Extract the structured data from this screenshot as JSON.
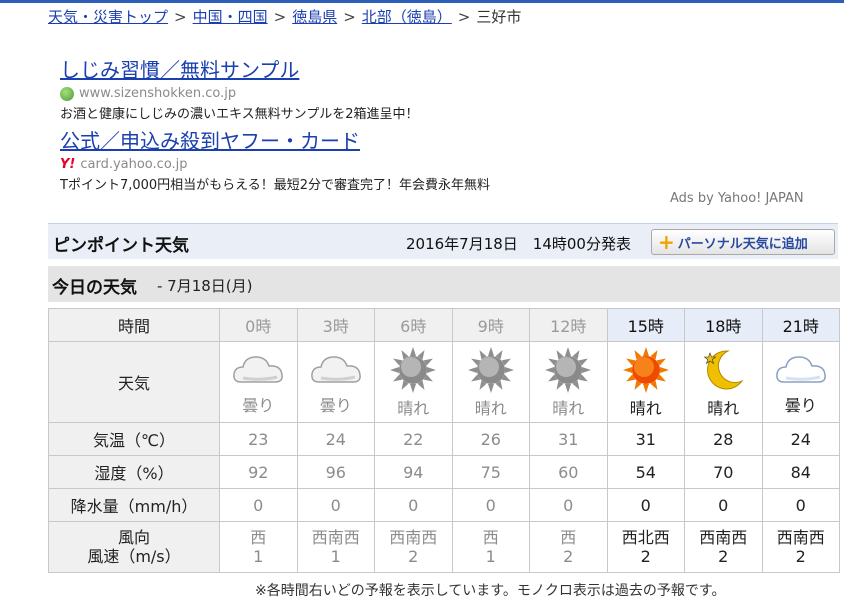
{
  "breadcrumb": {
    "items": [
      "天気・災害トップ",
      "中国・四国",
      "徳島県",
      "北部（徳島）"
    ],
    "current": "三好市",
    "separator": ">"
  },
  "ads": [
    {
      "title": "しじみ習慣／無料サンプル",
      "url": "www.sizenshokken.co.jp",
      "desc": "お酒と健康にしじみの濃いエキス無料サンプルを2箱進呈中！",
      "icon": "globe-icon"
    },
    {
      "title": "公式／申込み殺到ヤフー・カード",
      "url": "card.yahoo.co.jp",
      "desc": "Tポイント7,000円相当がもらえる！最短2分で審査完了！年会費永年無料",
      "icon": "yahoo-y-icon",
      "logo_text": "Y!"
    }
  ],
  "ads_by": "Ads by Yahoo! JAPAN",
  "pinpoint": {
    "title": "ピンポイント天気",
    "date": "2016年7月18日　14時00分発表",
    "add_button": "パーソナル天気に追加",
    "add_icon": "+"
  },
  "today": {
    "title": "今日の天気",
    "date": " - 7月18日(月)"
  },
  "table": {
    "row_labels": {
      "time": "時間",
      "weather": "天気",
      "temp": "気温（℃）",
      "humidity": "湿度（%）",
      "precip": "降水量（mm/h）",
      "wind_dir": "風向",
      "wind_speed": "風速（m/s）"
    },
    "columns": [
      {
        "hour": "0時",
        "weather": "曇り",
        "icon": "cloud-icon",
        "temp": "23",
        "humidity": "92",
        "precip": "0",
        "wind_dir": "西",
        "wind_speed": "1",
        "past": true
      },
      {
        "hour": "3時",
        "weather": "曇り",
        "icon": "cloud-icon",
        "temp": "24",
        "humidity": "96",
        "precip": "0",
        "wind_dir": "西南西",
        "wind_speed": "1",
        "past": true
      },
      {
        "hour": "6時",
        "weather": "晴れ",
        "icon": "sun-icon",
        "temp": "22",
        "humidity": "94",
        "precip": "0",
        "wind_dir": "西南西",
        "wind_speed": "2",
        "past": true
      },
      {
        "hour": "9時",
        "weather": "晴れ",
        "icon": "sun-icon",
        "temp": "26",
        "humidity": "75",
        "precip": "0",
        "wind_dir": "西",
        "wind_speed": "1",
        "past": true
      },
      {
        "hour": "12時",
        "weather": "晴れ",
        "icon": "sun-icon",
        "temp": "31",
        "humidity": "60",
        "precip": "0",
        "wind_dir": "西",
        "wind_speed": "2",
        "past": true
      },
      {
        "hour": "15時",
        "weather": "晴れ",
        "icon": "sun-icon",
        "temp": "31",
        "humidity": "54",
        "precip": "0",
        "wind_dir": "西北西",
        "wind_speed": "2",
        "past": false
      },
      {
        "hour": "18時",
        "weather": "晴れ",
        "icon": "moon-icon",
        "temp": "28",
        "humidity": "70",
        "precip": "0",
        "wind_dir": "西南西",
        "wind_speed": "2",
        "past": false
      },
      {
        "hour": "21時",
        "weather": "曇り",
        "icon": "cloud-icon",
        "temp": "24",
        "humidity": "84",
        "precip": "0",
        "wind_dir": "西南西",
        "wind_speed": "2",
        "past": false
      }
    ]
  },
  "note": "※各時間右いどの予報を表示しています。モノクロ表示は過去の予報です。",
  "colors": {
    "link": "#1a3fb0",
    "past_text": "#8c8c8c",
    "future_header_bg": "#e6ecf8",
    "sun": "#f04a00",
    "moon": "#f0c000"
  }
}
